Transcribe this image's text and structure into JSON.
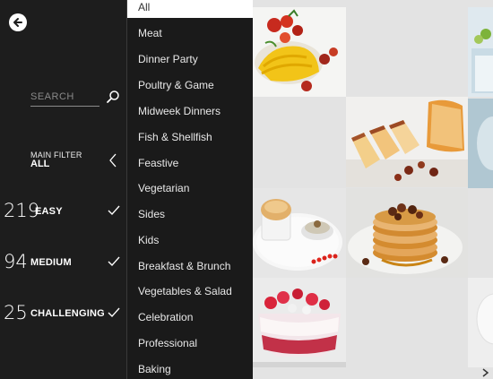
{
  "search": {
    "placeholder": "SEARCH"
  },
  "main_filter": {
    "label": "MAIN FILTER",
    "value": "ALL"
  },
  "difficulty": [
    {
      "count": "219",
      "label": "EASY"
    },
    {
      "count": "94",
      "label": "MEDIUM"
    },
    {
      "count": "25",
      "label": "CHALLENGING"
    }
  ],
  "categories": [
    "All",
    "Meat",
    "Dinner Party",
    "Poultry & Game",
    "Midweek Dinners",
    "Fish & Shellfish",
    "Feastive",
    "Vegetarian",
    "Sides",
    "Kids",
    "Breakfast & Brunch",
    "Vegetables & Salad",
    "Celebration",
    "Professional",
    "Baking"
  ],
  "selected_category": "All",
  "icons": {
    "back": "back-arrow-icon",
    "search": "search-icon",
    "collapse": "chevron-left-icon",
    "check": "check-icon",
    "scroll": "chevron-right-icon"
  },
  "colors": {
    "panel_bg": "#1d1d1d",
    "list_bg": "#1a1a1a",
    "selected_bg": "#ffffff",
    "grid_bg": "#e3e3e3"
  }
}
